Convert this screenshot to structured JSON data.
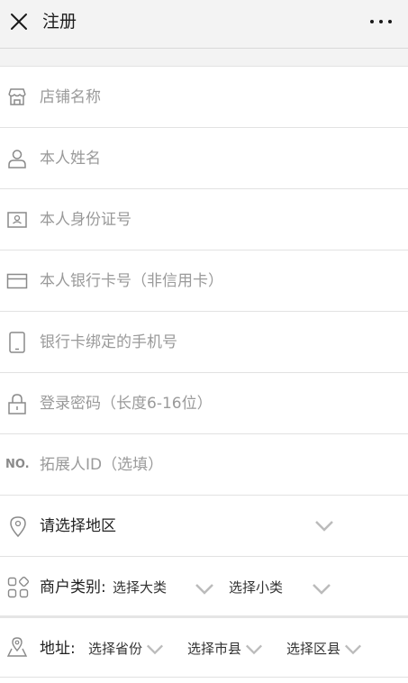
{
  "header": {
    "title": "注册"
  },
  "fields": {
    "shop_name": "店铺名称",
    "real_name": "本人姓名",
    "id_number": "本人身份证号",
    "bank_card": "本人银行卡号（非信用卡）",
    "bank_phone": "银行卡绑定的手机号",
    "password": "登录密码（长度6-16位）",
    "referrer_prefix": "NO.",
    "referrer": "拓展人ID（选填）"
  },
  "region": {
    "label": "请选择地区"
  },
  "category": {
    "label": "商户类别:",
    "major": "选择大类",
    "minor": "选择小类"
  },
  "address": {
    "label": "地址:",
    "province": "选择省份",
    "city": "选择市县",
    "district": "选择区县"
  }
}
